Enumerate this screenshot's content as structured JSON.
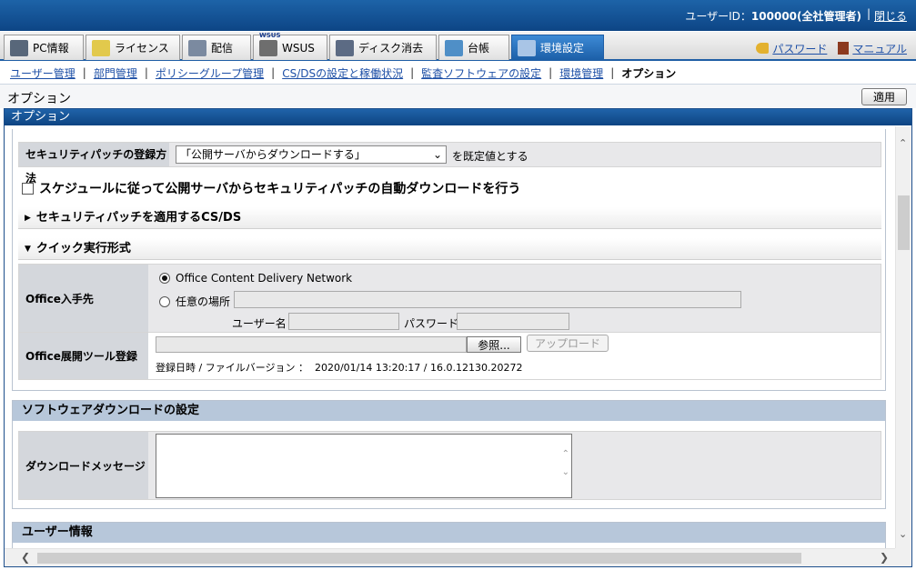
{
  "header": {
    "user_label": "ユーザーID：",
    "user_value": "100000(全社管理者)",
    "separator": "|",
    "close_label": "閉じる"
  },
  "tabs": [
    {
      "label": "PC情報",
      "icon": "pc-icon"
    },
    {
      "label": "ライセンス",
      "icon": "license-icon"
    },
    {
      "label": "配信",
      "icon": "distribution-icon"
    },
    {
      "label": "WSUS",
      "icon": "wsus-icon",
      "badge": "WSUS"
    },
    {
      "label": "ディスク消去",
      "icon": "disk-erase-icon"
    },
    {
      "label": "台帳",
      "icon": "ledger-icon"
    },
    {
      "label": "環境設定",
      "icon": "settings-icon",
      "active": true
    }
  ],
  "top_links": {
    "password": "パスワード",
    "manual": "マニュアル"
  },
  "subnav": {
    "items": [
      "ユーザー管理",
      "部門管理",
      "ポリシーグループ管理",
      "CS/DSの設定と稼働状況",
      "監査ソフトウェアの設定",
      "環境管理"
    ],
    "current": "オプション"
  },
  "page": {
    "title": "オプション",
    "apply_label": "適用",
    "frame_title": "オプション"
  },
  "security_patch": {
    "label": "セキュリティパッチの登録方法",
    "selected": "「公開サーバからダウンロードする」",
    "suffix": "を既定値とする",
    "auto_download_label": "スケジュールに従って公開サーバからセキュリティパッチの自動ダウンロードを行う",
    "auto_download_checked": false,
    "apply_cs_ds_section": "セキュリティパッチを適用するCS/DS"
  },
  "quick_run": {
    "section_title": "クイック実行形式",
    "source_label": "Office入手先",
    "option_cdn": "Office Content Delivery Network",
    "option_custom": "任意の場所",
    "username_label": "ユーザー名",
    "password_label": "パスワード",
    "tool_label": "Office展開ツール登録",
    "browse_label": "参照...",
    "upload_label": "アップロード",
    "info_prefix": "登録日時 / ファイルバージョン ：",
    "registered_at": "2020/01/14 13:20:17",
    "info_sep": "/",
    "file_version": "16.0.12130.20272"
  },
  "software_download": {
    "title": "ソフトウェアダウンロードの設定",
    "message_label": "ダウンロードメッセージ",
    "message_value": ""
  },
  "user_info": {
    "title": "ユーザー情報"
  }
}
